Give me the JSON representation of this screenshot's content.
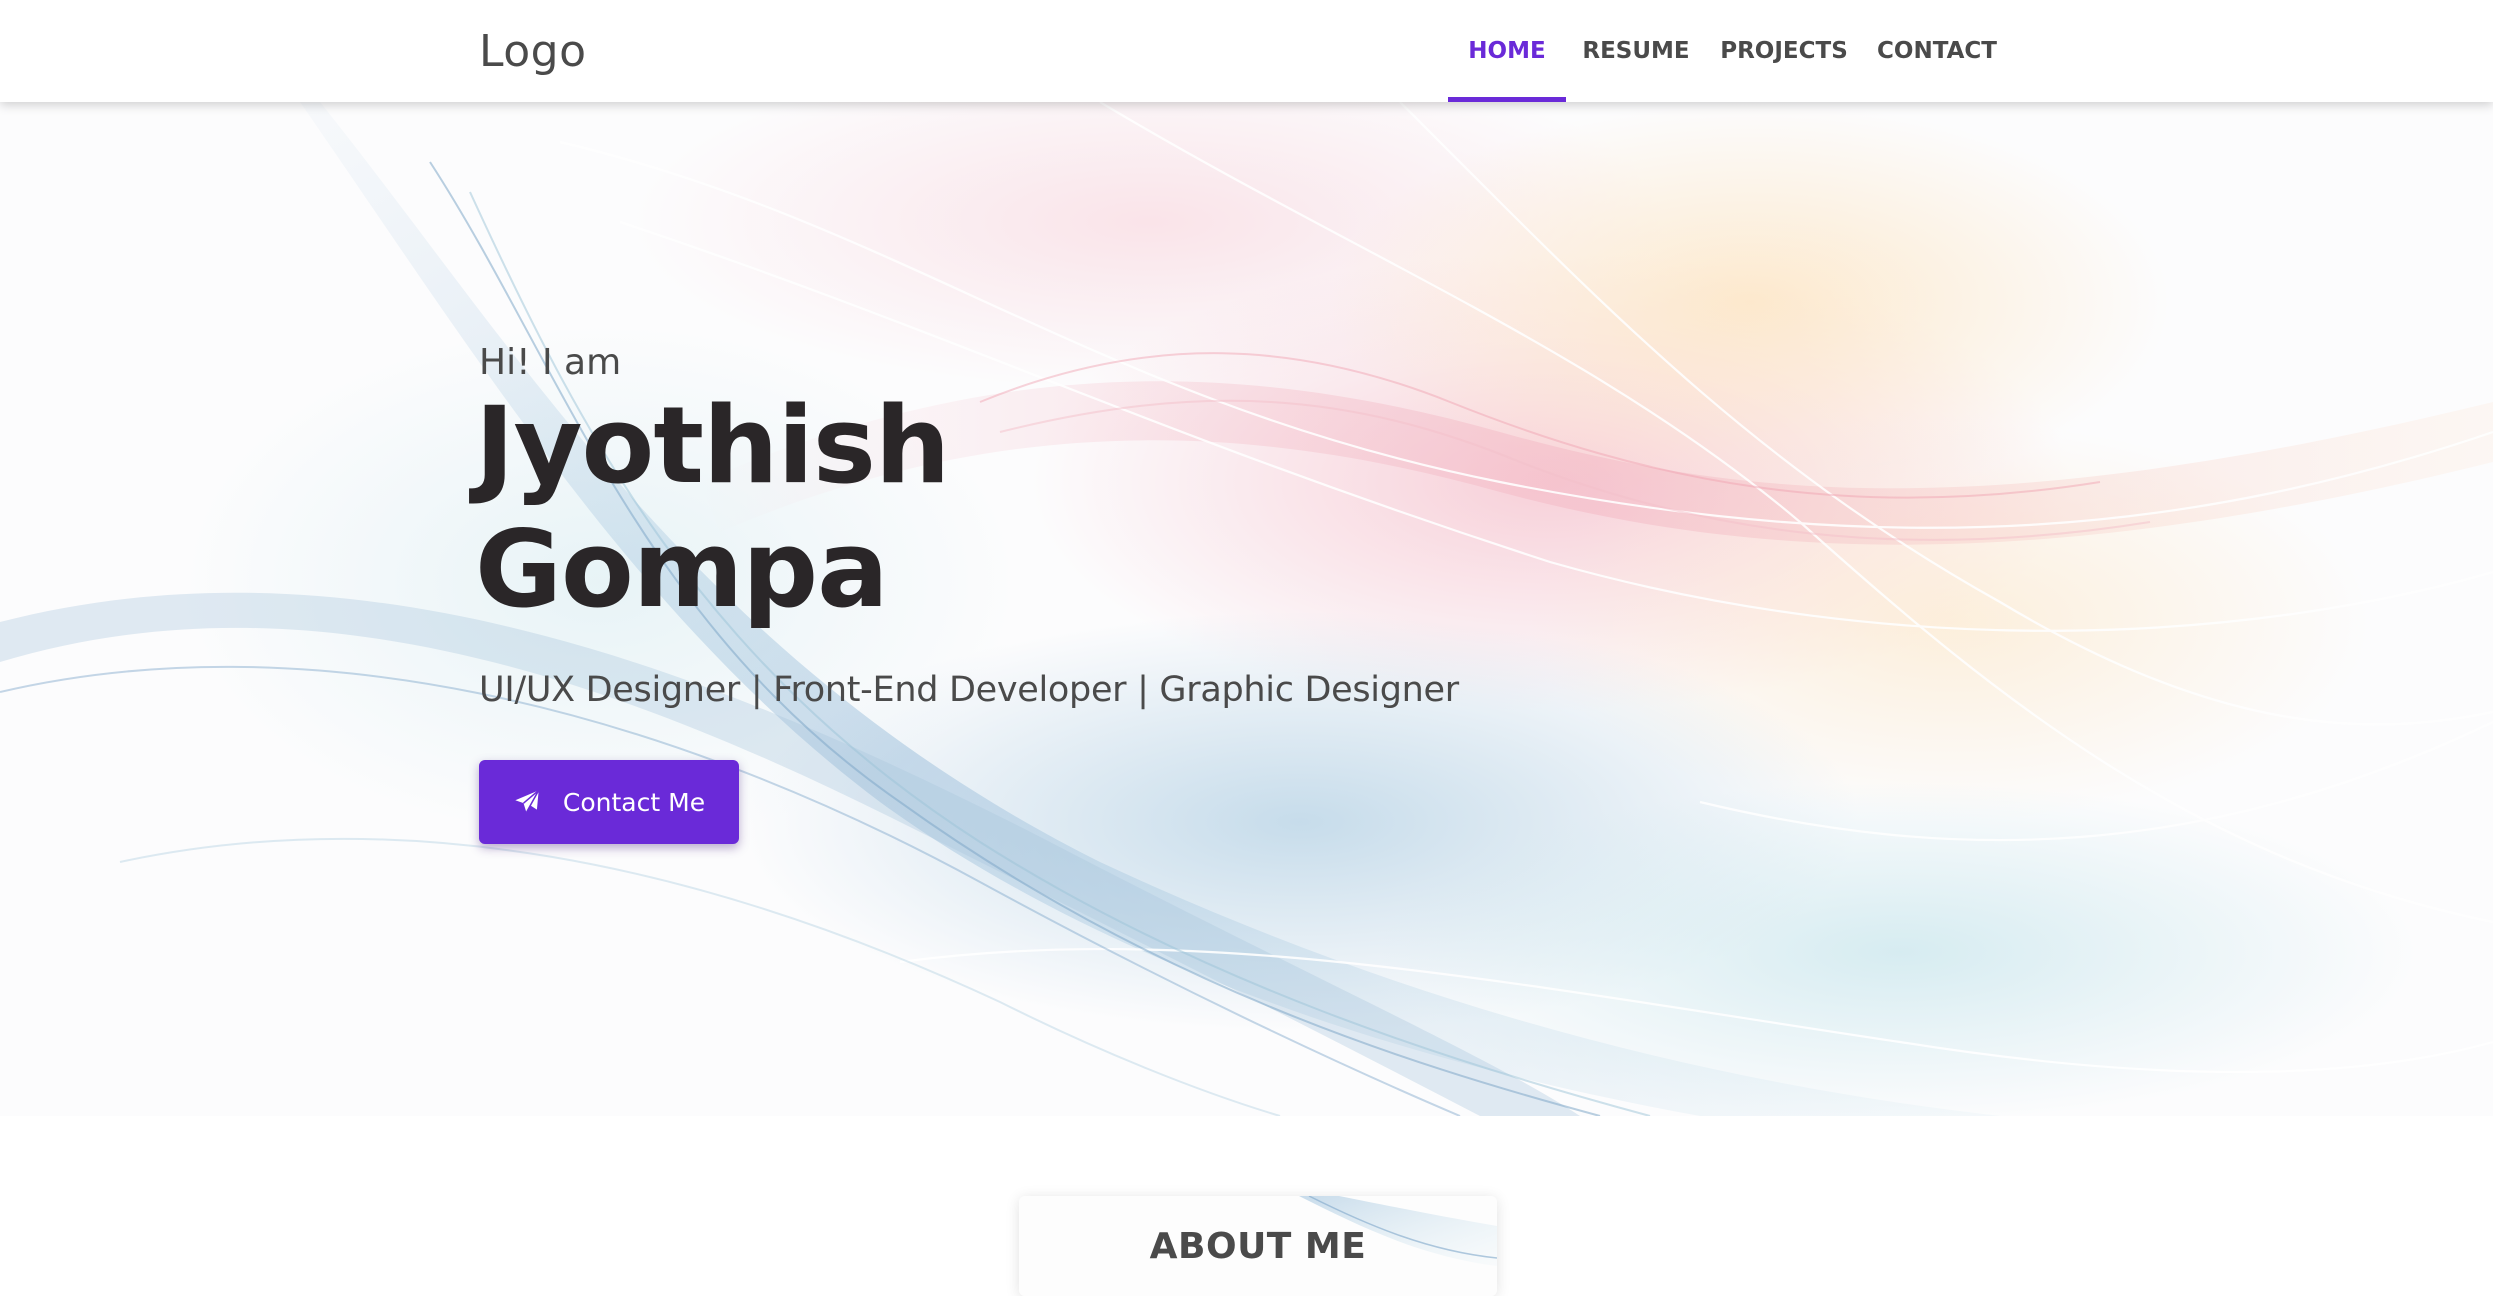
{
  "navbar": {
    "logo": "Logo",
    "items": [
      {
        "label": "HOME",
        "active": true
      },
      {
        "label": "RESUME",
        "active": false
      },
      {
        "label": "PROJECTS",
        "active": false
      },
      {
        "label": "CONTACT",
        "active": false
      }
    ]
  },
  "hero": {
    "greeting": "Hi! I am",
    "name_first": "Jyothish",
    "name_last": "Gompa",
    "tagline": "UI/UX Designer | Front-End Developer | Graphic Designer",
    "cta": {
      "label": "Contact Me",
      "icon": "paper-plane-icon"
    }
  },
  "about": {
    "title": "ABOUT ME"
  },
  "colors": {
    "accent": "#6a2ad8",
    "text_dark": "#2a2628",
    "text_muted": "#4a4a4a",
    "background": "#ffffff"
  }
}
